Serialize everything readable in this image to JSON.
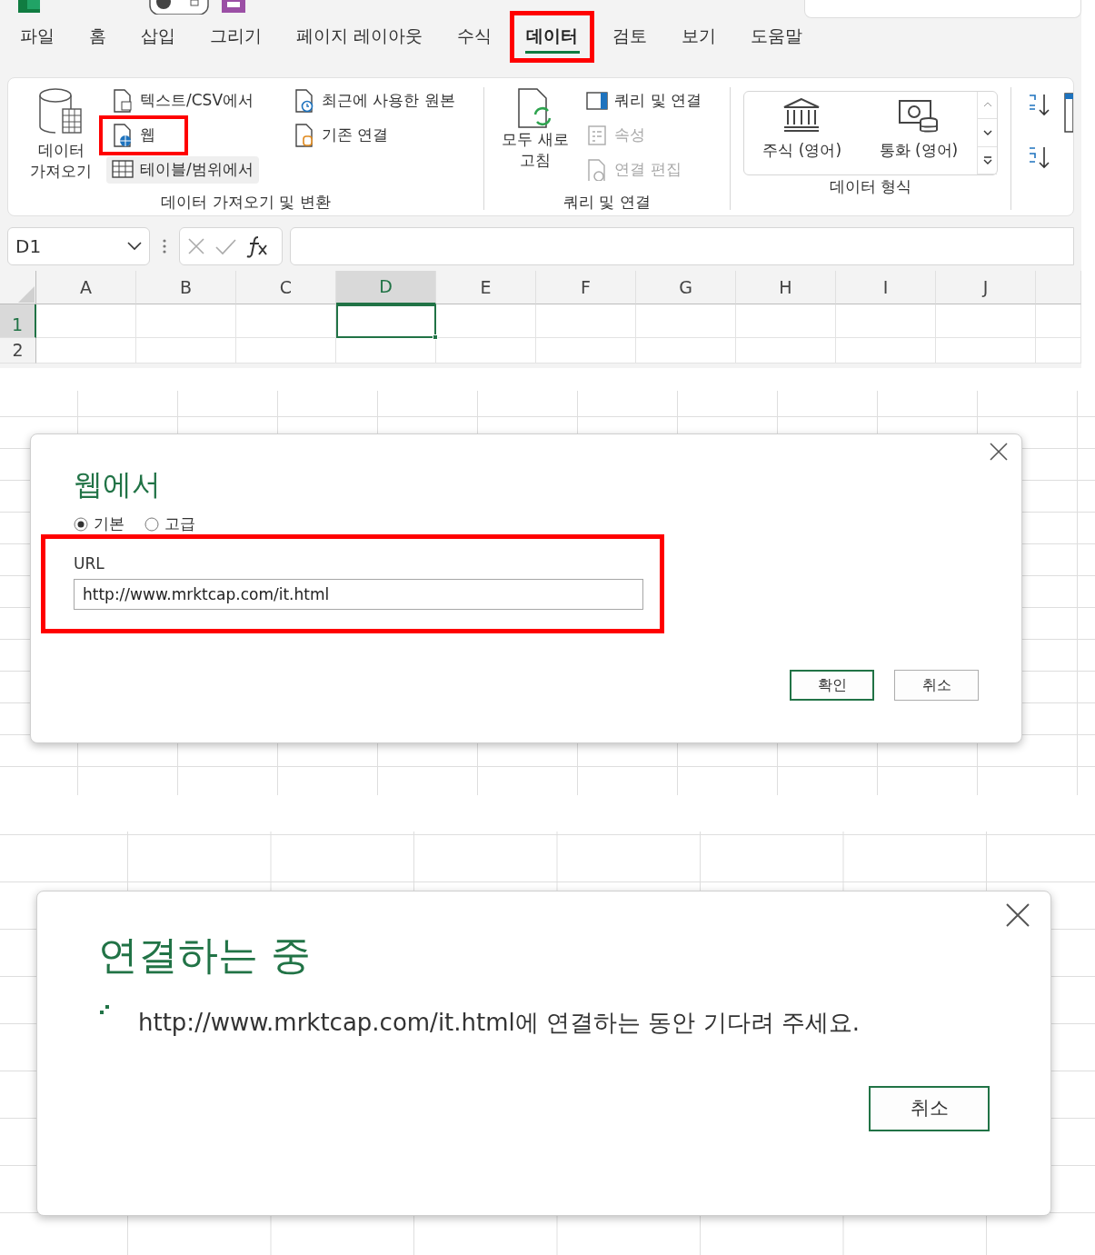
{
  "ribbon_tabs": [
    {
      "label": "파일",
      "selected": false,
      "highlighted": false
    },
    {
      "label": "홈",
      "selected": false,
      "highlighted": false
    },
    {
      "label": "삽입",
      "selected": false,
      "highlighted": false
    },
    {
      "label": "그리기",
      "selected": false,
      "highlighted": false
    },
    {
      "label": "페이지 레이아웃",
      "selected": false,
      "highlighted": false
    },
    {
      "label": "수식",
      "selected": false,
      "highlighted": false
    },
    {
      "label": "데이터",
      "selected": true,
      "highlighted": true
    },
    {
      "label": "검토",
      "selected": false,
      "highlighted": false
    },
    {
      "label": "보기",
      "selected": false,
      "highlighted": false
    },
    {
      "label": "도움말",
      "selected": false,
      "highlighted": false
    }
  ],
  "get_transform": {
    "label": "데이터 가져오기 및 변환",
    "get_data": "데이터 가져오기",
    "sources": [
      {
        "label": "텍스트/CSV에서",
        "highlighted": false,
        "hovered": false
      },
      {
        "label": "웹",
        "highlighted": true,
        "hovered": false
      },
      {
        "label": "테이블/범위에서",
        "highlighted": false,
        "hovered": true
      },
      {
        "label": "최근에 사용한 원본",
        "highlighted": false,
        "hovered": false
      },
      {
        "label": "기존 연결",
        "highlighted": false,
        "hovered": false
      }
    ]
  },
  "queries": {
    "label": "쿼리 및 연결",
    "refresh_all": "모두 새로 고침",
    "items": [
      {
        "label": "쿼리 및 연결",
        "disabled": false
      },
      {
        "label": "속성",
        "disabled": true
      },
      {
        "label": "연결 편집",
        "disabled": true
      }
    ]
  },
  "data_types": {
    "label": "데이터 형식",
    "items": [
      {
        "label": "주식 (영어)"
      },
      {
        "label": "통화 (영어)"
      }
    ]
  },
  "formula_bar": {
    "name_box": "D1"
  },
  "sheet": {
    "columns": [
      {
        "label": "A",
        "selected": false
      },
      {
        "label": "B",
        "selected": false
      },
      {
        "label": "C",
        "selected": false
      },
      {
        "label": "D",
        "selected": true
      },
      {
        "label": "E",
        "selected": false
      },
      {
        "label": "F",
        "selected": false
      },
      {
        "label": "G",
        "selected": false
      },
      {
        "label": "H",
        "selected": false
      },
      {
        "label": "I",
        "selected": false
      },
      {
        "label": "J",
        "selected": false
      }
    ],
    "rows": [
      {
        "label": "1",
        "selected": true
      },
      {
        "label": "2",
        "selected": false
      }
    ]
  },
  "web_dialog": {
    "title": "웹에서",
    "modes": [
      {
        "label": "기본",
        "selected": true
      },
      {
        "label": "고급",
        "selected": false
      }
    ],
    "url_label": "URL",
    "url": "http://www.mrktcap.com/it.html",
    "url_highlighted": true,
    "buttons": [
      {
        "label": "확인",
        "primary": true
      },
      {
        "label": "취소",
        "primary": false
      }
    ]
  },
  "connecting_dialog": {
    "title": "연결하는 중",
    "message": "http://www.mrktcap.com/it.html에 연결하는 동안 기다려 주세요.",
    "buttons": [
      {
        "label": "취소",
        "primary": true
      }
    ]
  }
}
